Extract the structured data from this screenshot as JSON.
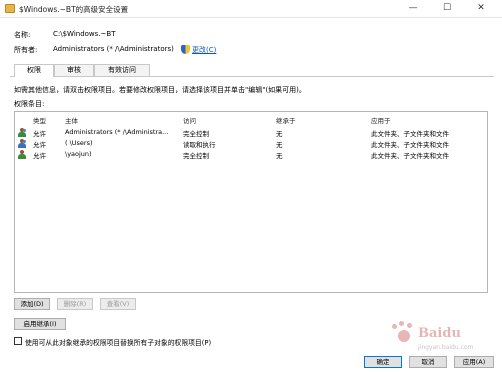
{
  "window": {
    "title": "$Windows.~BT的高级安全设置",
    "min_glyph": "—",
    "max_glyph": "☐",
    "close_glyph": "✕"
  },
  "info": {
    "name_label": "名称:",
    "name_value": "C:\\$Windows.~BT",
    "owner_label": "所有者:",
    "owner_value": "Administrators (*      /\\Administrators)",
    "change_link": "更改(C)"
  },
  "tabs": [
    {
      "label": "权限",
      "active": true
    },
    {
      "label": "审核",
      "active": false
    },
    {
      "label": "有效访问",
      "active": false
    }
  ],
  "hint": "如需其他信息，请双击权限项目。若要修改权限项目，请选择该项目并单击\"编辑\"(如果可用)。",
  "entries_label": "权限条目:",
  "table": {
    "columns": [
      "类型",
      "主体",
      "访问",
      "继承于",
      "应用于"
    ],
    "rows": [
      {
        "icon": "user-group-icon",
        "type": "允许",
        "principal": "Administrators (*      /\\Administra...",
        "access": "完全控制",
        "inherited": "无",
        "applies": "此文件夹、子文件夹和文件"
      },
      {
        "icon": "user-group-icon",
        "type": "允许",
        "principal": "      (    \\Users)",
        "access": "读取和执行",
        "inherited": "无",
        "applies": "此文件夹、子文件夹和文件"
      },
      {
        "icon": "user-icon",
        "type": "允许",
        "principal": "         \\yaojun)",
        "access": "完全控制",
        "inherited": "无",
        "applies": "此文件夹、子文件夹和文件"
      }
    ]
  },
  "buttons": {
    "add": "添加(D)",
    "remove": "删除(R)",
    "view": "查看(V)",
    "enable_inheritance": "启用继承(I)",
    "ok": "确定",
    "cancel": "取消",
    "apply": "应用(A)"
  },
  "replace_checkbox": {
    "label": "使用可从此对象继承的权限项目替换所有子对象的权限项目(P)",
    "checked": false
  },
  "watermark": {
    "text": "Baidu",
    "sub": "jingyan.baidu.com"
  }
}
